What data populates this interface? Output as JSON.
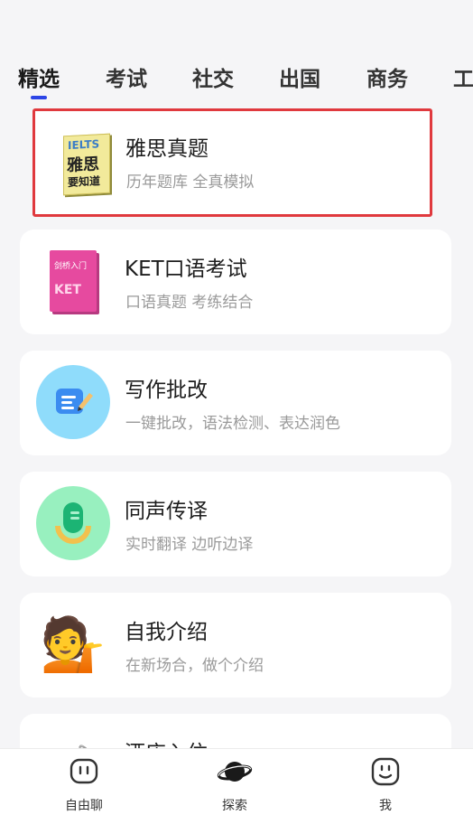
{
  "tabs": [
    "精选",
    "考试",
    "社交",
    "出国",
    "商务",
    "工"
  ],
  "active_tab": "精选",
  "cards": [
    {
      "title": "雅思真题",
      "subtitle": "历年题库 全真模拟",
      "icon": "ielts-book-icon",
      "thumb_text": [
        "IELTS",
        "雅思",
        "要知道"
      ]
    },
    {
      "title": "KET口语考试",
      "subtitle": "口语真题 考练结合",
      "icon": "ket-book-icon",
      "thumb_text": [
        "剑桥入门",
        "KET"
      ]
    },
    {
      "title": "写作批改",
      "subtitle": "一键批改，语法检测、表达润色",
      "icon": "writing-pencil-icon"
    },
    {
      "title": "同声传译",
      "subtitle": "实时翻译 边听边译",
      "icon": "microphone-icon"
    },
    {
      "title": "自我介绍",
      "subtitle": "在新场合，做个介绍",
      "icon": "person-tipping-hand-icon"
    },
    {
      "title": "酒店入住",
      "subtitle": "",
      "icon": "hotel-icon"
    }
  ],
  "highlight_color": "#e0393e",
  "accent_color": "#2c45e6",
  "bottom_nav": [
    {
      "label": "自由聊",
      "icon": "chat-face-icon"
    },
    {
      "label": "探索",
      "icon": "planet-icon"
    },
    {
      "label": "我",
      "icon": "profile-face-icon"
    }
  ]
}
